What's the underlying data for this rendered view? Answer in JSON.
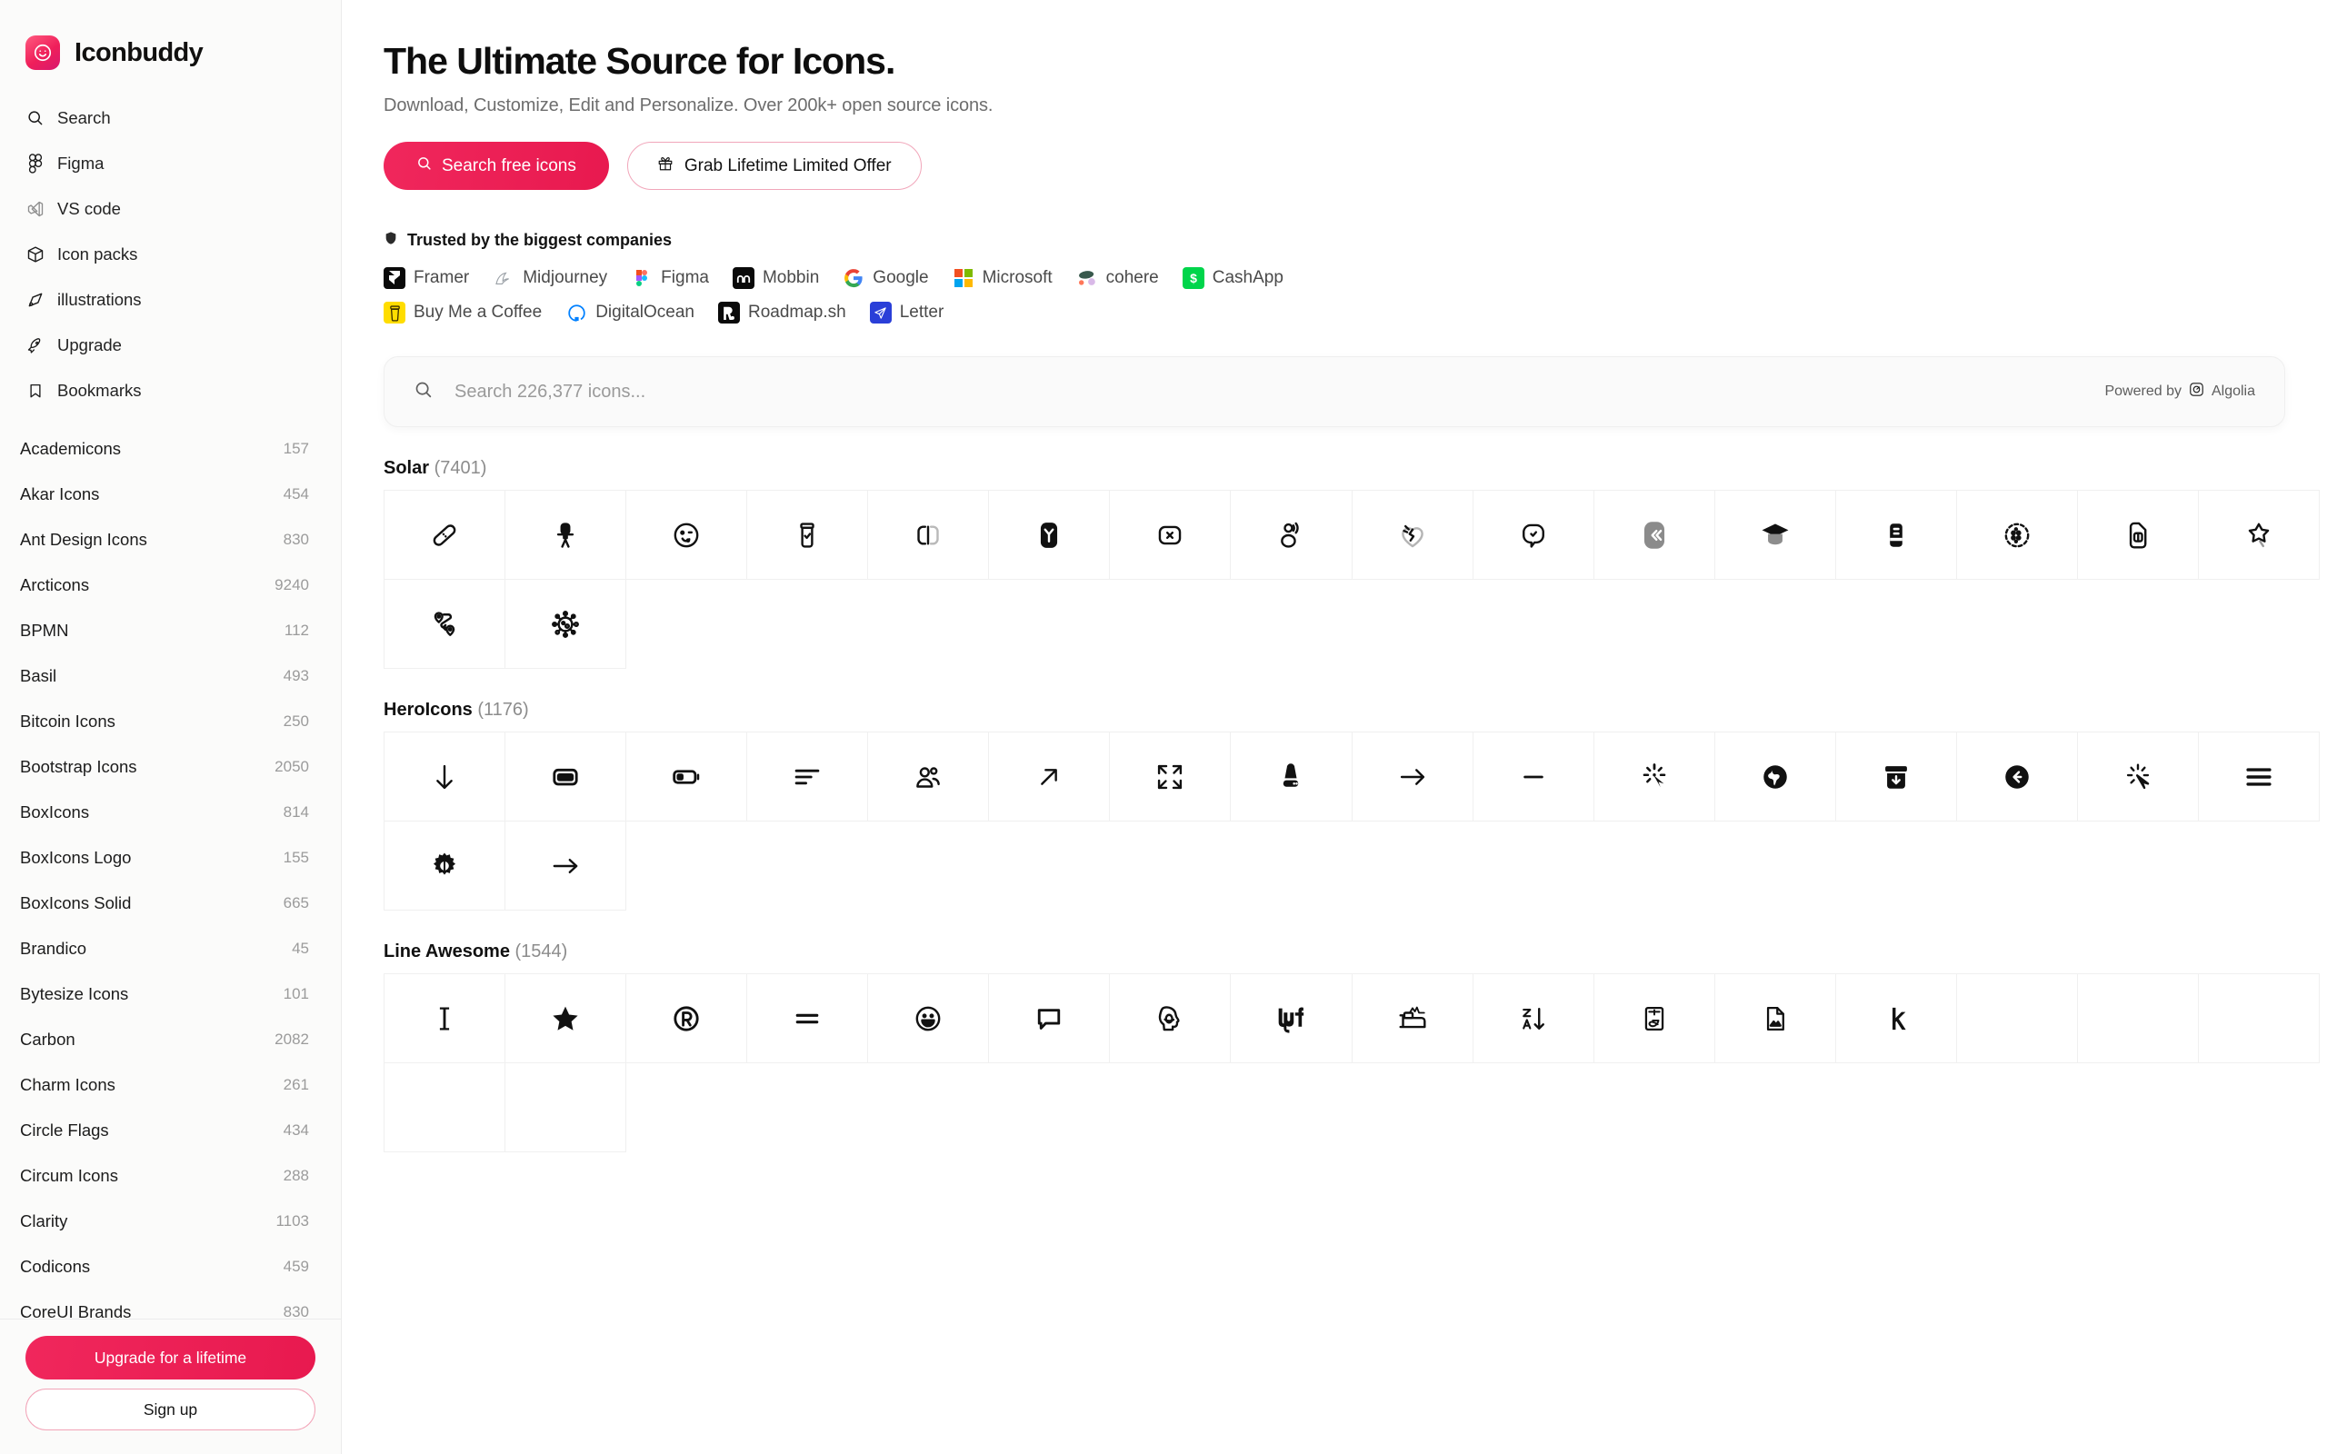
{
  "sidebar": {
    "brand": {
      "name": "Iconbuddy",
      "logo_icon": "smiley-logo-icon",
      "accent": "#e8194f"
    },
    "nav": [
      {
        "label": "Search",
        "icon": "search-icon"
      },
      {
        "label": "Figma",
        "icon": "figma-icon"
      },
      {
        "label": "VS code",
        "icon": "vscode-icon"
      },
      {
        "label": "Icon packs",
        "icon": "package-icon"
      },
      {
        "label": "illustrations",
        "icon": "pen-tool-icon"
      },
      {
        "label": "Upgrade",
        "icon": "rocket-icon"
      },
      {
        "label": "Bookmarks",
        "icon": "bookmark-icon"
      }
    ],
    "packs": [
      {
        "name": "Academicons",
        "count": "157"
      },
      {
        "name": "Akar Icons",
        "count": "454"
      },
      {
        "name": "Ant Design Icons",
        "count": "830"
      },
      {
        "name": "Arcticons",
        "count": "9240"
      },
      {
        "name": "BPMN",
        "count": "112"
      },
      {
        "name": "Basil",
        "count": "493"
      },
      {
        "name": "Bitcoin Icons",
        "count": "250"
      },
      {
        "name": "Bootstrap Icons",
        "count": "2050"
      },
      {
        "name": "BoxIcons",
        "count": "814"
      },
      {
        "name": "BoxIcons Logo",
        "count": "155"
      },
      {
        "name": "BoxIcons Solid",
        "count": "665"
      },
      {
        "name": "Brandico",
        "count": "45"
      },
      {
        "name": "Bytesize Icons",
        "count": "101"
      },
      {
        "name": "Carbon",
        "count": "2082"
      },
      {
        "name": "Charm Icons",
        "count": "261"
      },
      {
        "name": "Circle Flags",
        "count": "434"
      },
      {
        "name": "Circum Icons",
        "count": "288"
      },
      {
        "name": "Clarity",
        "count": "1103"
      },
      {
        "name": "Codicons",
        "count": "459"
      },
      {
        "name": "CoreUI Brands",
        "count": "830"
      }
    ],
    "cta": {
      "upgrade_label": "Upgrade for a lifetime",
      "signup_label": "Sign up"
    }
  },
  "hero": {
    "title": "The Ultimate Source for Icons.",
    "subtitle": "Download, Customize, Edit and Personalize. Over 200k+ open source icons.",
    "primary_button": "Search free icons",
    "secondary_button": "Grab Lifetime Limited Offer"
  },
  "trust": {
    "heading": "Trusted by the biggest companies",
    "heading_icon": "shield-icon",
    "row1": [
      {
        "name": "Framer",
        "mark": "framer-logo-icon"
      },
      {
        "name": "Midjourney",
        "mark": "midjourney-logo-icon"
      },
      {
        "name": "Figma",
        "mark": "figma-logo-icon"
      },
      {
        "name": "Mobbin",
        "mark": "mobbin-logo-icon"
      },
      {
        "name": "Google",
        "mark": "google-logo-icon"
      },
      {
        "name": "Microsoft",
        "mark": "microsoft-logo-icon"
      },
      {
        "name": "cohere",
        "mark": "cohere-logo-icon"
      },
      {
        "name": "CashApp",
        "mark": "cashapp-logo-icon"
      }
    ],
    "row2": [
      {
        "name": "Buy Me a Coffee",
        "mark": "buymeacoffee-logo-icon"
      },
      {
        "name": "DigitalOcean",
        "mark": "digitalocean-logo-icon"
      },
      {
        "name": "Roadmap.sh",
        "mark": "roadmapsh-logo-icon"
      },
      {
        "name": "Letter",
        "mark": "letter-logo-icon"
      }
    ]
  },
  "search": {
    "placeholder": "Search 226,377 icons...",
    "value": "",
    "icon": "search-icon",
    "powered_by": "Powered by",
    "provider": "Algolia"
  },
  "sections": [
    {
      "name": "Solar",
      "count": "(7401)",
      "icons": [
        "bandage-icon",
        "office-chair-icon",
        "smiley-wink-icon",
        "jar-check-icon",
        "copy-link-icon",
        "tuning-square-filled-icon",
        "close-square-icon",
        "user-speak-icon",
        "heart-broken-icon",
        "chat-check-icon",
        "double-chevron-left-icon",
        "graduation-cap-icon",
        "book-filled-icon",
        "dots-circle-icon",
        "sim-card-icon",
        "star-fall-icon",
        "route-icon",
        "virus-icon"
      ]
    },
    {
      "name": "HeroIcons",
      "count": "(1176)",
      "icons": [
        "arrow-down-icon",
        "credit-card-icon",
        "battery-low-icon",
        "bars-3-bottom-left-icon",
        "user-group-icon",
        "arrow-up-right-icon",
        "arrows-pointing-out-icon",
        "server-filled-icon",
        "arrow-right-icon",
        "minus-icon",
        "cursor-arrow-rays-icon",
        "globe-americas-filled-icon",
        "archive-box-arrow-down-filled-icon",
        "arrow-left-circle-filled-icon",
        "cursor-arrow-rays-outline-icon",
        "bars-3-icon",
        "cog-6-tooth-filled-icon",
        "arrow-long-right-icon"
      ]
    },
    {
      "name": "Line Awesome",
      "count": "(1544)",
      "icons": [
        "i-cursor-icon",
        "star-filled-icon",
        "registered-icon",
        "equals-icon",
        "laugh-icon",
        "comment-icon",
        "head-side-mask-icon",
        "lyft-logo-icon",
        "procedures-icon",
        "sort-alpha-down-alt-icon",
        "alipay-logo-icon",
        "file-image-icon",
        "keycdn-logo-icon",
        "blank-1-icon",
        "blank-2-icon",
        "blank-3-icon",
        "blank-4-icon",
        "blank-5-icon"
      ]
    }
  ]
}
